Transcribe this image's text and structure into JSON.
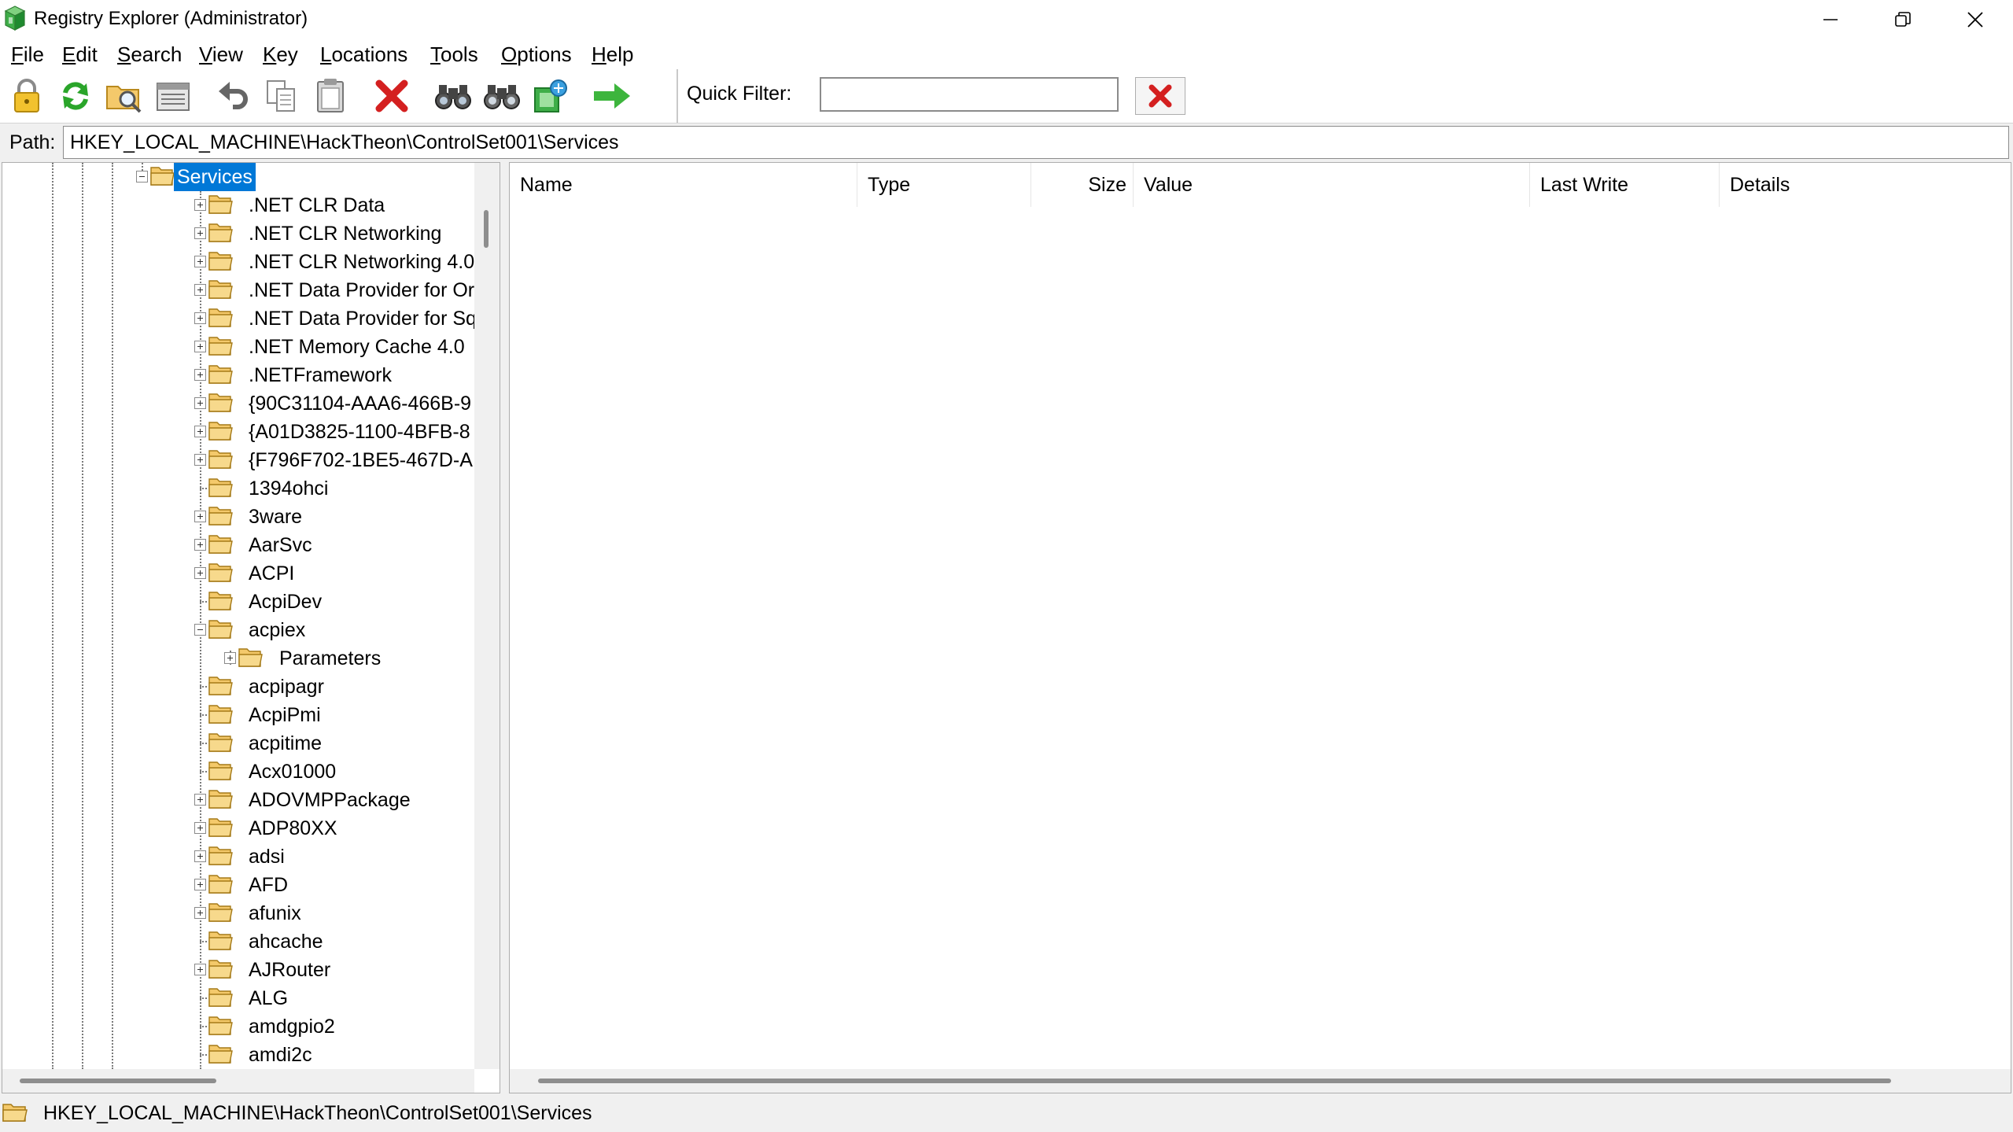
{
  "window": {
    "title": "Registry Explorer (Administrator)",
    "controls": [
      "minimize",
      "restore",
      "close"
    ]
  },
  "menu": [
    {
      "label": "File",
      "accel": "F",
      "rest": "ile"
    },
    {
      "label": "Edit",
      "accel": "E",
      "rest": "dit"
    },
    {
      "label": "Search",
      "accel": "S",
      "rest": "earch"
    },
    {
      "label": "View",
      "accel": "V",
      "rest": "iew"
    },
    {
      "label": "Key",
      "accel": "K",
      "rest": "ey"
    },
    {
      "label": "Locations",
      "accel": "L",
      "rest": "ocations"
    },
    {
      "label": "Tools",
      "accel": "T",
      "rest": "ools"
    },
    {
      "label": "Options",
      "accel": "O",
      "rest": "ptions"
    },
    {
      "label": "Help",
      "accel": "H",
      "rest": "elp"
    }
  ],
  "toolbar": {
    "buttons": [
      "lock-icon",
      "refresh-icon",
      "open-hive-icon",
      "hive-list-icon",
      "undo-icon",
      "copy-icon",
      "paste-icon",
      "delete-icon",
      "find-icon",
      "find-next-icon",
      "export-icon",
      "go-icon"
    ],
    "quick_filter_label": "Quick Filter:",
    "quick_filter_value": "",
    "quick_filter_clear": "clear-filter-icon"
  },
  "path": {
    "label": "Path:",
    "value": "HKEY_LOCAL_MACHINE\\HackTheon\\ControlSet001\\Services"
  },
  "tree": {
    "selected": "Services",
    "items": [
      {
        "label": "Services",
        "level": 0,
        "expander": "minus",
        "selected": true
      },
      {
        "label": ".NET CLR Data",
        "level": 1,
        "expander": "plus"
      },
      {
        "label": ".NET CLR Networking",
        "level": 1,
        "expander": "plus"
      },
      {
        "label": ".NET CLR Networking 4.0",
        "level": 1,
        "expander": "plus"
      },
      {
        "label": ".NET Data Provider for Or",
        "level": 1,
        "expander": "plus"
      },
      {
        "label": ".NET Data Provider for Sq",
        "level": 1,
        "expander": "plus"
      },
      {
        "label": ".NET Memory Cache 4.0",
        "level": 1,
        "expander": "plus"
      },
      {
        "label": ".NETFramework",
        "level": 1,
        "expander": "plus"
      },
      {
        "label": "{90C31104-AAA6-466B-9",
        "level": 1,
        "expander": "plus"
      },
      {
        "label": "{A01D3825-1100-4BFB-8",
        "level": 1,
        "expander": "plus"
      },
      {
        "label": "{F796F702-1BE5-467D-A",
        "level": 1,
        "expander": "plus"
      },
      {
        "label": "1394ohci",
        "level": 1,
        "expander": "none"
      },
      {
        "label": "3ware",
        "level": 1,
        "expander": "plus"
      },
      {
        "label": "AarSvc",
        "level": 1,
        "expander": "plus"
      },
      {
        "label": "ACPI",
        "level": 1,
        "expander": "plus"
      },
      {
        "label": "AcpiDev",
        "level": 1,
        "expander": "none"
      },
      {
        "label": "acpiex",
        "level": 1,
        "expander": "minus"
      },
      {
        "label": "Parameters",
        "level": 2,
        "expander": "plus"
      },
      {
        "label": "acpipagr",
        "level": 1,
        "expander": "none"
      },
      {
        "label": "AcpiPmi",
        "level": 1,
        "expander": "none"
      },
      {
        "label": "acpitime",
        "level": 1,
        "expander": "none"
      },
      {
        "label": "Acx01000",
        "level": 1,
        "expander": "none"
      },
      {
        "label": "ADOVMPPackage",
        "level": 1,
        "expander": "plus"
      },
      {
        "label": "ADP80XX",
        "level": 1,
        "expander": "plus"
      },
      {
        "label": "adsi",
        "level": 1,
        "expander": "plus"
      },
      {
        "label": "AFD",
        "level": 1,
        "expander": "plus"
      },
      {
        "label": "afunix",
        "level": 1,
        "expander": "plus"
      },
      {
        "label": "ahcache",
        "level": 1,
        "expander": "none"
      },
      {
        "label": "AJRouter",
        "level": 1,
        "expander": "plus"
      },
      {
        "label": "ALG",
        "level": 1,
        "expander": "none"
      },
      {
        "label": "amdgpio2",
        "level": 1,
        "expander": "none"
      },
      {
        "label": "amdi2c",
        "level": 1,
        "expander": "none"
      }
    ]
  },
  "values_table": {
    "columns": [
      "Name",
      "Type",
      "Size",
      "Value",
      "Last Write",
      "Details"
    ],
    "rows": []
  },
  "status": {
    "text": "HKEY_LOCAL_MACHINE\\HackTheon\\ControlSet001\\Services"
  },
  "colors": {
    "selection": "#0078d7",
    "folder": "#f4c96b",
    "delete_red": "#d42020",
    "refresh_green": "#2aa52a"
  }
}
